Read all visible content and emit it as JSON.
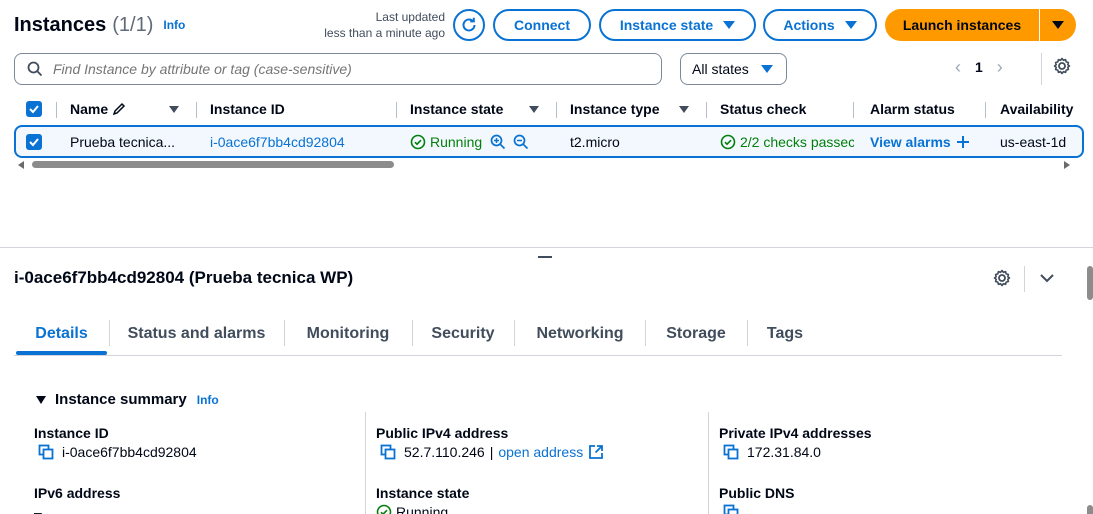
{
  "header": {
    "title": "Instances",
    "count": "(1/1)",
    "info_label": "Info",
    "last_updated_line1": "Last updated",
    "last_updated_line2": "less than a minute ago",
    "connect_label": "Connect",
    "instance_state_label": "Instance state",
    "actions_label": "Actions",
    "launch_label": "Launch instances"
  },
  "filter": {
    "search_placeholder": "Find Instance by attribute or tag (case-sensitive)",
    "states_label": "All states",
    "page_number": "1"
  },
  "table": {
    "columns": [
      "Name",
      "Instance ID",
      "Instance state",
      "Instance type",
      "Status check",
      "Alarm status",
      "Availability"
    ],
    "rows": [
      {
        "name": "Prueba tecnica...",
        "instance_id": "i-0ace6f7bb4cd92804",
        "state": "Running",
        "type": "t2.micro",
        "status_check": "2/2 checks passec",
        "alarm": "View alarms",
        "az": "us-east-1d"
      }
    ]
  },
  "details": {
    "title": "i-0ace6f7bb4cd92804 (Prueba tecnica WP)",
    "tabs": [
      "Details",
      "Status and alarms",
      "Monitoring",
      "Security",
      "Networking",
      "Storage",
      "Tags"
    ],
    "summary_label": "Instance summary",
    "summary_info": "Info",
    "fields": {
      "instance_id_label": "Instance ID",
      "instance_id_value": "i-0ace6f7bb4cd92804",
      "public_ipv4_label": "Public IPv4 address",
      "public_ipv4_value": "52.7.110.246",
      "public_ipv4_sep": "|",
      "open_address": "open address",
      "private_ipv4_label": "Private IPv4 addresses",
      "private_ipv4_value": "172.31.84.0",
      "ipv6_label": "IPv6 address",
      "ipv6_value": "–",
      "instance_state_label": "Instance state",
      "instance_state_value": "Running",
      "public_dns_label": "Public DNS"
    }
  },
  "colors": {
    "accent": "#0972d3",
    "launch": "#ff9900",
    "success": "#037f0c"
  }
}
